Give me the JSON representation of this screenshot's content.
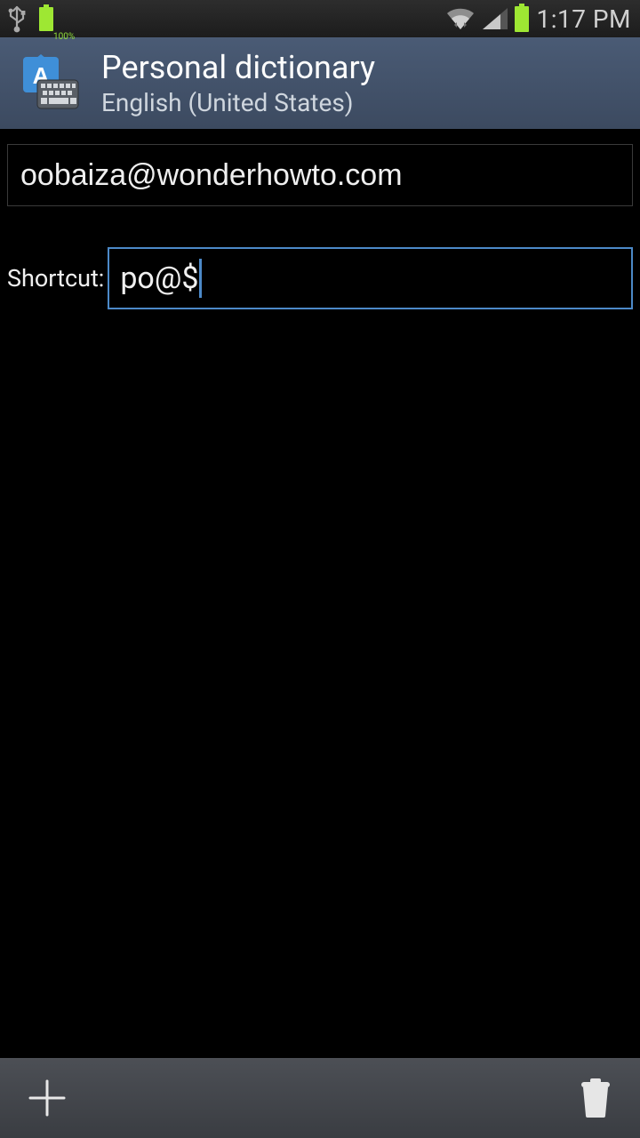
{
  "status_bar": {
    "battery_percent_text": "100%",
    "time": "1:17 PM"
  },
  "header": {
    "title": "Personal dictionary",
    "subtitle": "English (United States)"
  },
  "main": {
    "word_value": "oobaiza@wonderhowto.com",
    "shortcut_label": "Shortcut:",
    "shortcut_value": "po@$"
  },
  "colors": {
    "accent": "#4c89c8",
    "battery_green": "#9ee733"
  }
}
